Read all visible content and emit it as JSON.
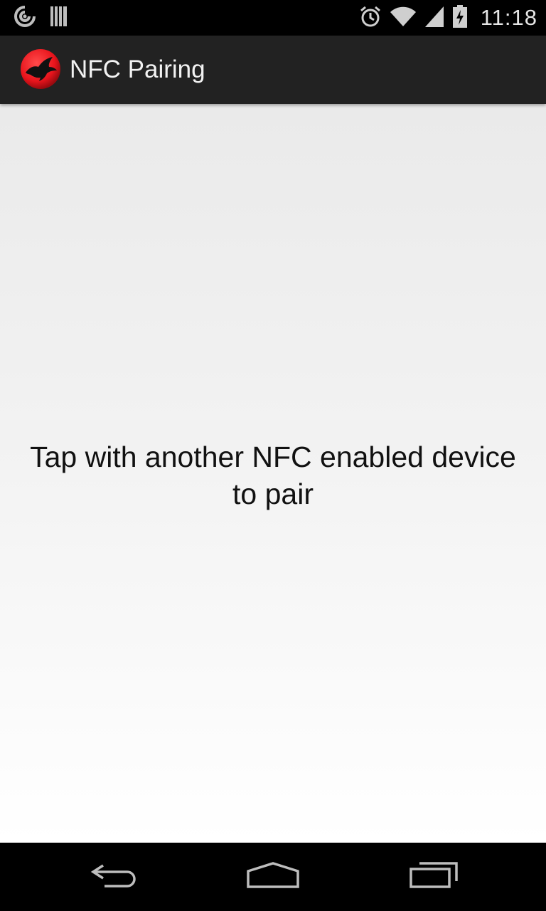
{
  "status_bar": {
    "time": "11:18",
    "left_icons": [
      "sync-icon",
      "barcode-icon"
    ],
    "right_icons": [
      "alarm-icon",
      "wifi-icon",
      "signal-icon",
      "battery-charging-icon"
    ]
  },
  "action_bar": {
    "title": "NFC Pairing",
    "icon": "raven-logo-icon"
  },
  "main": {
    "message": "Tap with another NFC enabled device to pair"
  },
  "nav_bar": {
    "buttons": [
      "back-icon",
      "home-icon",
      "recent-apps-icon"
    ]
  },
  "colors": {
    "action_bar_bg": "#222222",
    "accent_red": "#e8141c",
    "content_top": "#eaeaea",
    "content_bottom": "#ffffff"
  }
}
